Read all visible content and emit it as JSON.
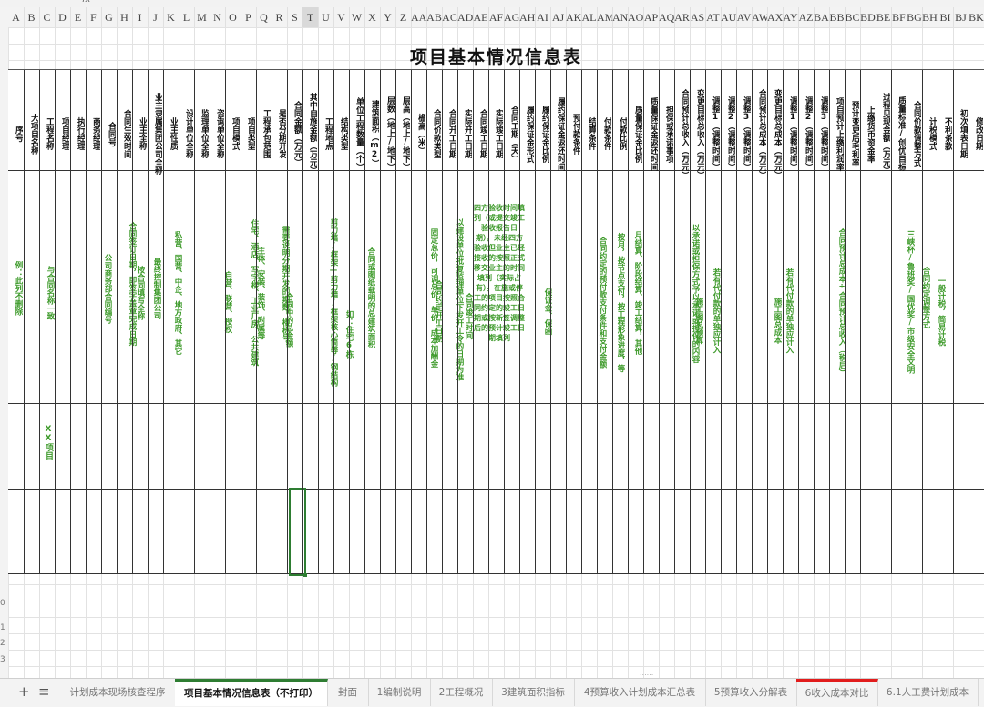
{
  "formula_bar": {
    "fx": "fx"
  },
  "columns": [
    "A",
    "B",
    "C",
    "D",
    "E",
    "F",
    "G",
    "H",
    "I",
    "J",
    "K",
    "L",
    "M",
    "N",
    "O",
    "P",
    "Q",
    "R",
    "S",
    "T",
    "U",
    "V",
    "W",
    "X",
    "Y",
    "Z",
    "AA",
    "AB",
    "AC",
    "AD",
    "AE",
    "AF",
    "AG",
    "AH",
    "AI",
    "AJ",
    "AK",
    "AL",
    "AM",
    "AN",
    "AO",
    "AP",
    "AQ",
    "AR",
    "AS",
    "AT",
    "AU",
    "AV",
    "AW",
    "AX",
    "AY",
    "AZ",
    "BA",
    "BB",
    "BC",
    "BD",
    "BE",
    "BF",
    "BG",
    "BH",
    "BI",
    "BJ",
    "BK"
  ],
  "selected_column": "T",
  "row_numbers": [
    "0",
    "1",
    "2",
    "3"
  ],
  "sheet": {
    "title": "项目基本情况信息表",
    "headers": [
      "序号",
      "大项目名称",
      "工程名称",
      "项目经理",
      "执行经理",
      "商务经理",
      "合同号",
      "合同生效时间",
      "业主全称",
      "业主隶属集团公司全称",
      "业主性质",
      "设计单位全称",
      "监理单位全称",
      "咨询单位全称",
      "项目模式",
      "项目类型",
      "工程承包范围",
      "是否分期开发",
      "合同金额（万元）",
      "其中自施金额（万元）",
      "工程地点",
      "结构类型",
      "单位工程数量（个）",
      "建筑面积（m2）",
      "层数（地上/地下）",
      "层高（地上/地下）",
      "檐高（米）",
      "合同价款类型",
      "合同开工日期",
      "实际开工日期",
      "合同竣工日期",
      "实际竣工日期",
      "合同工期（天）",
      "履约保证金形式",
      "履约保证金比例",
      "履约保证金返还时间",
      "预付款条件",
      "结算条件",
      "付款条件",
      "付款比例",
      "质量保证金比例",
      "质量保证金返还时间",
      "担保或承诺事项",
      "合同预计总收入（万元）",
      "变更目标总收入（万元）",
      "调整1（调整时间）",
      "调整2（调整时间）",
      "调整3（调整时间）",
      "合同预计总成本（万元）",
      "变更目标总成本（万元）",
      "调整1（调整时间）",
      "调整2（调整时间）",
      "调整3（调整时间）",
      "项目预计上缴利润率",
      "预计变更后毛利率",
      "上缴货币资金率",
      "过程见现金额（万元）",
      "质量标准/创优目标",
      "合同价款调整方式",
      "计税模式",
      "不利条款",
      "初次填表日期",
      "修改日期"
    ],
    "notes": {
      "seq": "例：此列不删除",
      "project_name": "与合同名称一致",
      "contract_no": "公司商务部合同编号",
      "effective": "合同签订日期，即签字盖章完成日期",
      "owner": "按合同填写全称",
      "group": "最终控制集团公司",
      "nature": "私营、国营、中企、地方政府、其它",
      "mode": "自营、联营、授权",
      "type": "住宅、酒店、写字楼、工业厂房、公共建筑",
      "scope": "主体、安装、装饰、附属等",
      "phased": "需要说明分期开发的期数，楼栋号",
      "amount": "合同中的总金额",
      "structure": "剪力墙/框架—剪力墙/框架核心筒等/钢结构",
      "units": "如：住宅6栋",
      "area": "合同或图纸载明的总建筑面积",
      "price_type": "固定总价，可调总价，单价，成本加酬金",
      "contract_start": "合同约定开工日期",
      "actual_start": "以建设单位批复监理单位下发开工令的日期为准",
      "contract_end": "合同竣工时间",
      "actual_end": "四方验收时间填列（或提交竣工验收报告日期），未经四方验收但业主已经接收的按照正式移交业主的时间填列（实际占有）。在施或停工的项目按照合同约定的竣工日期或按新签调整后的预计竣工日期填列",
      "bond_form": "保证金、保函",
      "prepay": "合同约定的预付款支付条件和支付金额",
      "settlement": "月结算、阶段结算、竣工结算，其他",
      "payment": "按月，按节点支付，按工程形象进度，等",
      "guarantee": "以承诺或担保方式予以承诺或担保的内容",
      "income": "施工图总预算",
      "income_change": "若有代付款的单独应计入",
      "cost": "施工图总成本",
      "cost_change": "若有代付款的单独应计入",
      "profit": "合同预计总成本÷合同预计总收入（税后）",
      "quality": "三峡杯/鲁班奖/国优奖/市级安全文明",
      "price_adjust": "合同约定调整方式",
      "tax": "一般计税，简易计税"
    },
    "project_row": "XX项目"
  },
  "tabs": [
    {
      "label": "计划成本现场核查程序"
    },
    {
      "label": "项目基本情况信息表（不打印）"
    },
    {
      "label": "封面"
    },
    {
      "label": "1编制说明"
    },
    {
      "label": "2工程概况"
    },
    {
      "label": "3建筑面积指标"
    },
    {
      "label": "4预算收入计划成本汇总表"
    },
    {
      "label": "5预算收入分解表"
    },
    {
      "label": "6收入成本对比"
    },
    {
      "label": "6.1人工费计划成本"
    }
  ],
  "tab_controls": {
    "add": "+",
    "menu": "≡"
  },
  "scroll_handle": "......",
  "colors": {
    "note_green": "#3d9a2a",
    "active_tab": "#2e7d32",
    "red_tab": "#e21c1c"
  }
}
